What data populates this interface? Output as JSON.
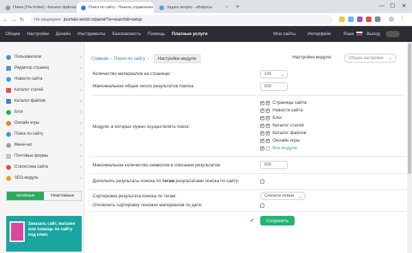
{
  "browser": {
    "tabs": [
      {
        "title": "Поиск [The Kritter] - Каталог файлов",
        "close": "×"
      },
      {
        "title": "Поиск по сайту - Панель управления",
        "close": "×"
      },
      {
        "title": "Задать вопрос - uBotpocы",
        "close": "×"
      }
    ],
    "new_tab": "+",
    "window_controls": [
      "—",
      "☐",
      "✕"
    ],
    "nav": {
      "back": "←",
      "forward": "→",
      "reload": "↻"
    },
    "address": {
      "security": "Не защищено",
      "url": "journals-world.ru/panel/?a=search&l=setup"
    }
  },
  "topnav": {
    "items": [
      "Общее",
      "Настройки",
      "Дизайн",
      "Инструменты",
      "Безопасность",
      "Помощь",
      "Платные услуги"
    ],
    "right": {
      "my_sites": "Мои сайты",
      "interface": "Интерфейс",
      "lang": "Язык",
      "logout": "Выход"
    }
  },
  "sidebar": {
    "items": [
      "Пользователи",
      "Редактор страниц",
      "Новости сайта",
      "Каталог статей",
      "Каталог файлов",
      "Блог",
      "Онлайн игры",
      "Поиск по сайту",
      "Мини-чат",
      "Почтовые формы",
      "Статистика сайта",
      "SEO-модуль"
    ],
    "toggle": {
      "active": "Активные",
      "inactive": "Неактивные"
    },
    "promo": "Заказать сайт, магазин или помощь по сайту под ключ."
  },
  "breadcrumb": {
    "home": "Главная",
    "section": "Поиск по сайту",
    "current": "Настройки модуля"
  },
  "module_settings": {
    "label": "Настройки модуля:",
    "value": "Общие настройки",
    "arrow": "❯"
  },
  "form": {
    "per_page_label": "Количество материалов на странице:",
    "per_page_value": "100",
    "max_results_label": "Максимальное общее число результатов поиска:",
    "max_results_value": "500",
    "modules_label": "Модули, в которых нужно осуществлять поиск:",
    "modules": [
      "Страницы сайта",
      "Новости сайта",
      "Блог",
      "Каталог статей",
      "Каталог файлов",
      "Онлайн игры"
    ],
    "all_modules": "Все модули",
    "max_chars_label": "Максимальное количество символов в описании результатов:",
    "max_chars_value": "500",
    "supplement_label_pre": "Дополнять результаты поиска по",
    "supplement_label_bold": "тегам",
    "supplement_label_post": "результатами поиска по сайту:",
    "sort_label": "Сортировка результата поиска по тегам:",
    "sort_value": "Сначала новые",
    "disable_sort_label": "Отключить сортировку похожих материалов по дате:",
    "save": "Сохранить",
    "check_mark": "✔",
    "select_arrow": "⌄"
  },
  "colors": {
    "accent": "#22b573",
    "link": "#2a75c7",
    "topnav": "#2b2d33"
  }
}
